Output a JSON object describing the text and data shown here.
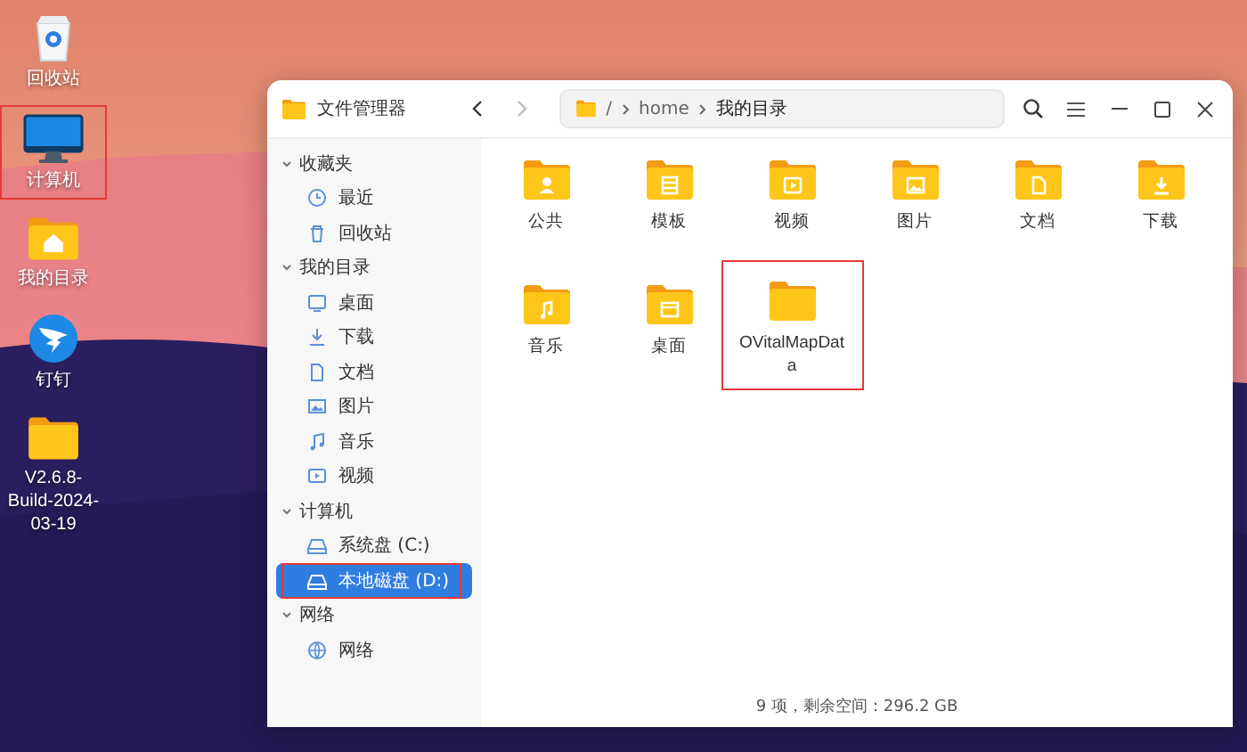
{
  "desktop_icons": [
    {
      "label": "回收站",
      "kind": "trash",
      "highlighted": false
    },
    {
      "label": "计算机",
      "kind": "computer",
      "highlighted": true
    },
    {
      "label": "我的目录",
      "kind": "home",
      "highlighted": false
    },
    {
      "label": "钉钉",
      "kind": "app",
      "highlighted": false
    },
    {
      "label": "V2.6.8-Build-2024-03-19",
      "kind": "folder",
      "highlighted": false
    }
  ],
  "window": {
    "title": "文件管理器",
    "back_disabled": false,
    "forward_disabled": true,
    "path": [
      "/",
      "home",
      "我的目录"
    ]
  },
  "sidebar": {
    "groups": [
      {
        "label": "收藏夹",
        "expanded": true,
        "items": [
          {
            "label": "最近",
            "kind": "recent",
            "selected": false,
            "highlighted": false
          },
          {
            "label": "回收站",
            "kind": "trash",
            "selected": false,
            "highlighted": false
          }
        ]
      },
      {
        "label": "我的目录",
        "expanded": true,
        "items": [
          {
            "label": "桌面",
            "kind": "desktop",
            "selected": false,
            "highlighted": false
          },
          {
            "label": "下载",
            "kind": "download",
            "selected": false,
            "highlighted": false
          },
          {
            "label": "文档",
            "kind": "document",
            "selected": false,
            "highlighted": false
          },
          {
            "label": "图片",
            "kind": "picture",
            "selected": false,
            "highlighted": false
          },
          {
            "label": "音乐",
            "kind": "music",
            "selected": false,
            "highlighted": false
          },
          {
            "label": "视频",
            "kind": "video",
            "selected": false,
            "highlighted": false
          }
        ]
      },
      {
        "label": "计算机",
        "expanded": true,
        "items": [
          {
            "label": "系统盘 (C:)",
            "kind": "drive",
            "selected": false,
            "highlighted": false
          },
          {
            "label": "本地磁盘 (D:)",
            "kind": "drive",
            "selected": true,
            "highlighted": true
          }
        ]
      },
      {
        "label": "网络",
        "expanded": true,
        "items": [
          {
            "label": "网络",
            "kind": "network",
            "selected": false,
            "highlighted": false
          }
        ]
      }
    ]
  },
  "folders": [
    {
      "name": "公共",
      "kind": "public",
      "highlighted": false
    },
    {
      "name": "模板",
      "kind": "templates",
      "highlighted": false
    },
    {
      "name": "视频",
      "kind": "video",
      "highlighted": false
    },
    {
      "name": "图片",
      "kind": "pictures",
      "highlighted": false
    },
    {
      "name": "文档",
      "kind": "documents",
      "highlighted": false
    },
    {
      "name": "下载",
      "kind": "downloads",
      "highlighted": false
    },
    {
      "name": "音乐",
      "kind": "music",
      "highlighted": false
    },
    {
      "name": "桌面",
      "kind": "desktop",
      "highlighted": false
    },
    {
      "name": "OVitalMapData",
      "kind": "plain",
      "highlighted": true
    }
  ],
  "status_bar": "9 项，剩余空间：296.2 GB"
}
